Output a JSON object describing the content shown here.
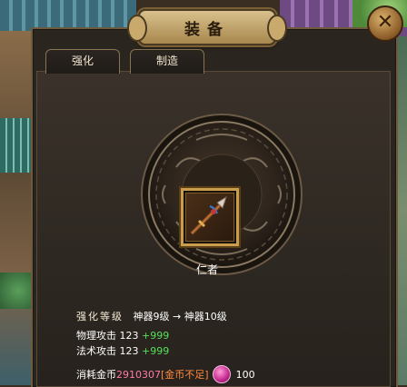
{
  "window": {
    "title": "装备",
    "close_label": "✕"
  },
  "tabs": [
    {
      "label": "强化"
    },
    {
      "label": "制造"
    }
  ],
  "item": {
    "name": "仁者"
  },
  "stats": {
    "enhance_label": "强化等级",
    "from_level": "神器9级",
    "arrow": "→",
    "to_level": "神器10级",
    "physical_attack_label": "物理攻击",
    "physical_attack_value": "123",
    "physical_attack_bonus": "+999",
    "magic_attack_label": "法术攻击",
    "magic_attack_value": "123",
    "magic_attack_bonus": "+999"
  },
  "cost": {
    "label": "消耗金币",
    "amount": "2910307",
    "warning": "[金币不足]",
    "item_count": "100"
  },
  "colors": {
    "bonus": "#55e05a",
    "gold_amount": "#ff7aa8",
    "warning": "#ff8a3c"
  }
}
